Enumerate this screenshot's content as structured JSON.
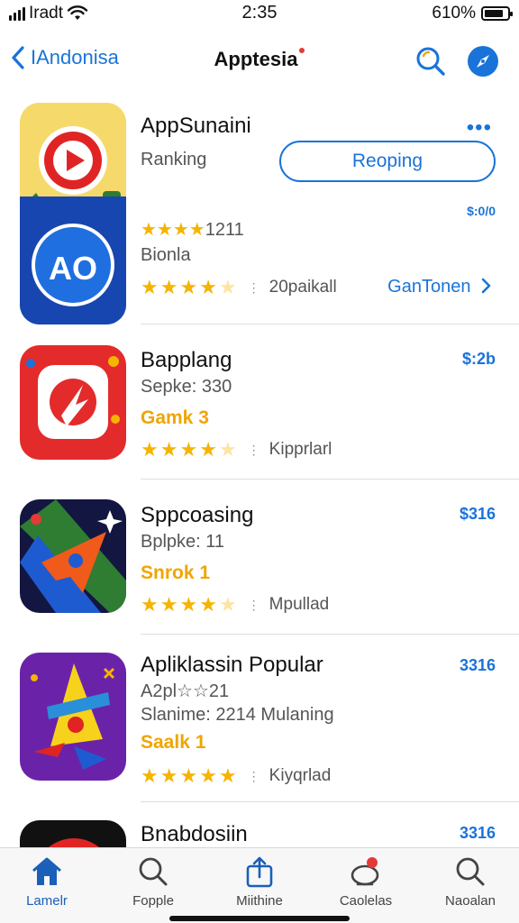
{
  "status": {
    "carrier": "Iradt",
    "time": "2:35",
    "battery": "610%",
    "battery_level": 0.85
  },
  "nav": {
    "back_label": "IAndonisa",
    "title": "Apptesia"
  },
  "featured": {
    "name": "AppSunaini",
    "subtitle": "Ranking",
    "action_label": "Reoping",
    "more_label": "•••",
    "price": "$:0/0",
    "rating_text": "★★★★1211",
    "category": "Bionla",
    "stars_label": "20paikall",
    "link_label": "GanTonen",
    "rating": 4.5
  },
  "apps": [
    {
      "name": "Bapplang",
      "line1": "Sepke: 330",
      "tag": "Gamk 3",
      "stars_label": "Kipprlarl",
      "price": "$:2b",
      "rating": 4.5
    },
    {
      "name": "Sppcoasing",
      "line1": "Bplpke: 11",
      "tag": "Snrok 1",
      "stars_label": "Mpullad",
      "price": "$316",
      "rating": 4.5
    },
    {
      "name": "Apliklassin Popular",
      "line1": "A2pl☆☆21",
      "line2": "Slanime: 2214 Mulaning",
      "tag": "Saalk 1",
      "stars_label": "Kiyqrlad",
      "price": "3316",
      "rating": 5
    },
    {
      "name": "Bnabdosiin",
      "price": "3316"
    }
  ],
  "tabs": [
    {
      "label": "Lamelr",
      "icon": "home-icon",
      "active": true
    },
    {
      "label": "Fopple",
      "icon": "search-icon",
      "active": false
    },
    {
      "label": "Miithine",
      "icon": "share-icon",
      "active": false
    },
    {
      "label": "Caolelas",
      "icon": "notification-icon",
      "active": false
    },
    {
      "label": "Naoalan",
      "icon": "search-icon",
      "active": false
    }
  ],
  "colors": {
    "accent": "#1a73d9",
    "star": "#f5b400",
    "tag": "#f0a500"
  }
}
